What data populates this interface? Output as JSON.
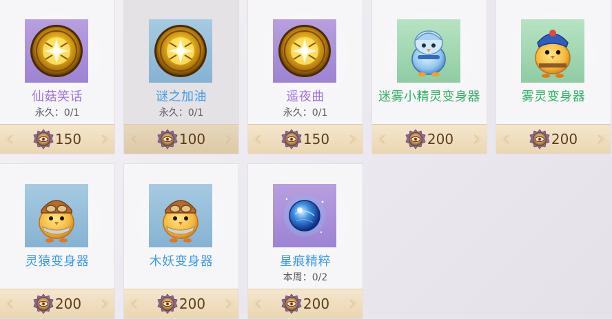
{
  "colors": {
    "name_purple": "#a070e4",
    "name_blue": "#3d9be6",
    "name_green": "#2fb063",
    "price_text": "#5b3d1a",
    "price_bar": "#f0dfc2"
  },
  "currency_icon": "eye-coin-icon",
  "items": [
    {
      "name": "仙菇笑话",
      "limit": "永久：0/1",
      "price": "150",
      "icon": "golden-disc-icon"
    },
    {
      "name": "谜之加油",
      "limit": "永久：0/1",
      "price": "100",
      "icon": "golden-disc-icon"
    },
    {
      "name": "遥夜曲",
      "limit": "永久：0/1",
      "price": "150",
      "icon": "golden-disc-icon"
    },
    {
      "name": "迷雾小精灵变身器",
      "limit": "",
      "price": "200",
      "icon": "blue-chick-icon"
    },
    {
      "name": "雾灵变身器",
      "limit": "",
      "price": "200",
      "icon": "pilot-chick-icon"
    },
    {
      "name": "灵猿变身器",
      "limit": "",
      "price": "200",
      "icon": "aviator-chick-icon"
    },
    {
      "name": "木妖变身器",
      "limit": "",
      "price": "200",
      "icon": "aviator-chick-icon"
    },
    {
      "name": "星痕精粹",
      "limit": "本周：0/2",
      "price": "200",
      "icon": "blue-orb-icon"
    }
  ]
}
